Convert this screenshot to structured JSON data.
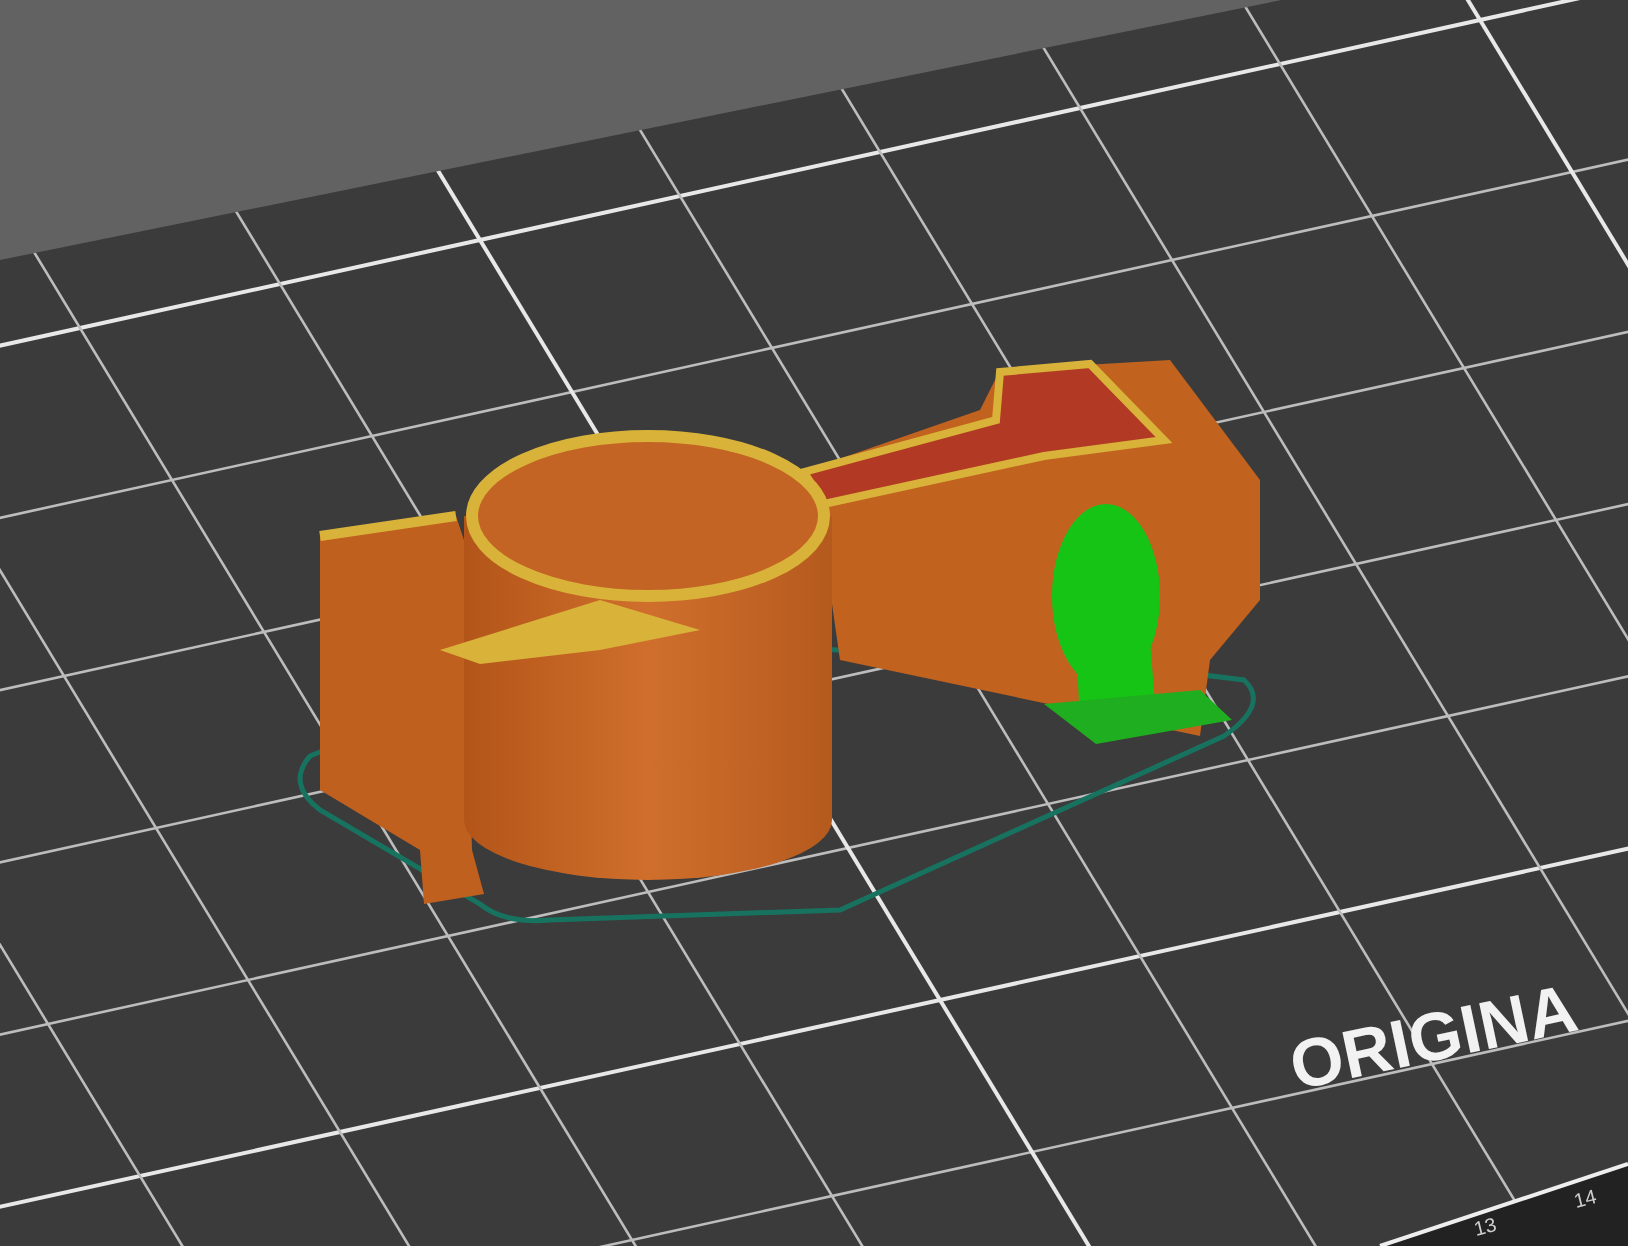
{
  "viewport": {
    "bed_logo": "ORIGINA",
    "axis_labels": [
      "13",
      "14"
    ]
  }
}
